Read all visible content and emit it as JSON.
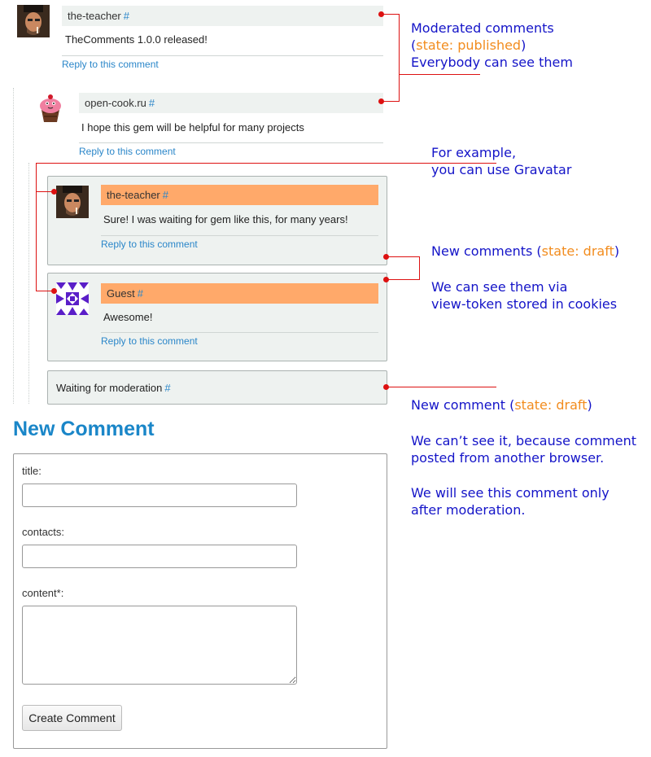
{
  "comments": [
    {
      "author": "the-teacher",
      "hash": "#",
      "text": "TheComments 1.0.0 released!",
      "reply": "Reply to this comment"
    },
    {
      "author": "open-cook.ru",
      "hash": "#",
      "text": "I hope this gem will be helpful for many projects",
      "reply": "Reply to this comment"
    },
    {
      "author": "the-teacher",
      "hash": "#",
      "text": "Sure! I was waiting for gem like this, for many years!",
      "reply": "Reply to this comment"
    },
    {
      "author": "Guest",
      "hash": "#",
      "text": "Awesome!",
      "reply": "Reply to this comment"
    }
  ],
  "waiting": {
    "text": "Waiting for moderation",
    "hash": "#"
  },
  "annotations": {
    "moderated": {
      "line1": "Moderated comments",
      "line2_open": "(",
      "line2_state": "state: published",
      "line2_close": ")",
      "line3": "Everybody can see them"
    },
    "gravatar": {
      "line1": "For example,",
      "line2": "you can use Gravatar"
    },
    "new_comments": {
      "prefix": "New comments (",
      "state": "state: draft",
      "suffix": ")"
    },
    "view_token": {
      "line1": "We can see them via",
      "line2": "view-token stored in cookies"
    },
    "new_comment": {
      "prefix": "New comment (",
      "state": "state: draft",
      "suffix": ")"
    },
    "cant_see": {
      "line1": "We can’t see it, because comment",
      "line2": "posted from another browser."
    },
    "after_mod": {
      "line1": "We will see this comment only",
      "line2": "after moderation."
    }
  },
  "form": {
    "heading": "New Comment",
    "title_label": "title:",
    "contacts_label": "contacts:",
    "content_label": "content*:",
    "submit": "Create Comment"
  },
  "colors": {
    "link": "#2a86c9",
    "draft_header": "#ffa96a",
    "annotation": "#1414c8",
    "state": "#f28c1e",
    "pointer": "#dd1111"
  }
}
